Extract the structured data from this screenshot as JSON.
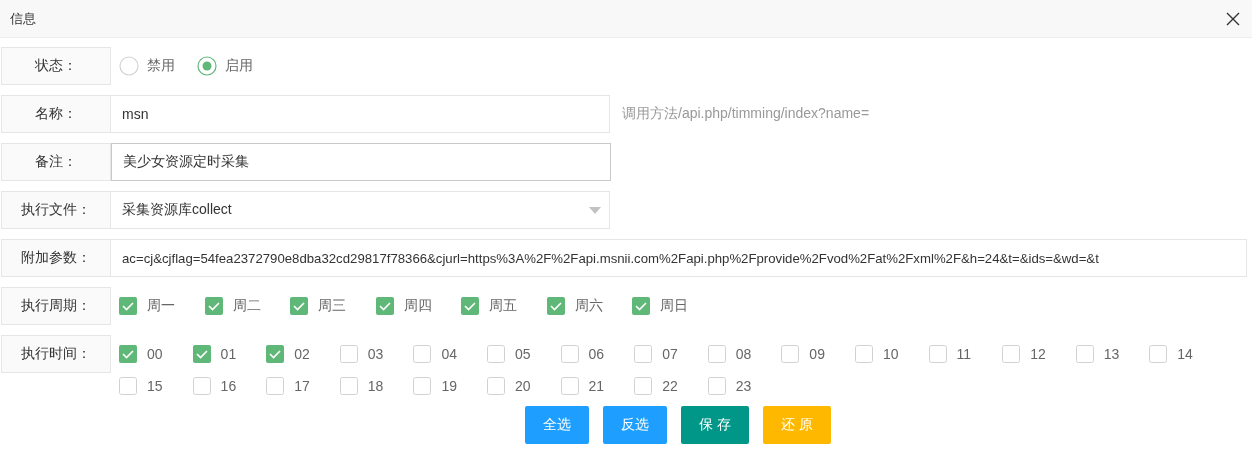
{
  "dialog": {
    "title": "信息"
  },
  "rows": [
    {
      "kind": "radio",
      "label": "状态：",
      "options": [
        {
          "label": "禁用",
          "selected": false
        },
        {
          "label": "启用",
          "selected": true
        }
      ]
    },
    {
      "kind": "input",
      "label": "名称：",
      "value": "msn",
      "focused": false,
      "note": "调用方法/api.php/timming/index?name="
    },
    {
      "kind": "input",
      "label": "备注：",
      "value": "美少女资源定时采集",
      "focused": true
    },
    {
      "kind": "select",
      "label": "执行文件：",
      "value": "采集资源库collect"
    },
    {
      "kind": "wide",
      "label": "附加参数：",
      "value": "ac=cj&cjflag=54fea2372790e8dba32cd29817f78366&cjurl=https%3A%2F%2Fapi.msnii.com%2Fapi.php%2Fprovide%2Fvod%2Fat%2Fxml%2F&h=24&t=&ids=&wd=&t"
    },
    {
      "kind": "days",
      "label": "执行周期：",
      "options": [
        {
          "label": "周一",
          "checked": true
        },
        {
          "label": "周二",
          "checked": true
        },
        {
          "label": "周三",
          "checked": true
        },
        {
          "label": "周四",
          "checked": true
        },
        {
          "label": "周五",
          "checked": true
        },
        {
          "label": "周六",
          "checked": true
        },
        {
          "label": "周日",
          "checked": true
        }
      ]
    },
    {
      "kind": "hours",
      "label": "执行时间：",
      "options": [
        {
          "label": "00",
          "checked": true
        },
        {
          "label": "01",
          "checked": true
        },
        {
          "label": "02",
          "checked": true
        },
        {
          "label": "03",
          "checked": false
        },
        {
          "label": "04",
          "checked": false
        },
        {
          "label": "05",
          "checked": false
        },
        {
          "label": "06",
          "checked": false
        },
        {
          "label": "07",
          "checked": false
        },
        {
          "label": "08",
          "checked": false
        },
        {
          "label": "09",
          "checked": false
        },
        {
          "label": "10",
          "checked": false
        },
        {
          "label": "11",
          "checked": false
        },
        {
          "label": "12",
          "checked": false
        },
        {
          "label": "13",
          "checked": false
        },
        {
          "label": "14",
          "checked": false
        },
        {
          "label": "15",
          "checked": false
        },
        {
          "label": "16",
          "checked": false
        },
        {
          "label": "17",
          "checked": false
        },
        {
          "label": "18",
          "checked": false
        },
        {
          "label": "19",
          "checked": false
        },
        {
          "label": "20",
          "checked": false
        },
        {
          "label": "21",
          "checked": false
        },
        {
          "label": "22",
          "checked": false
        },
        {
          "label": "23",
          "checked": false
        }
      ]
    }
  ],
  "buttons": [
    {
      "label": "全选",
      "kind": "normal"
    },
    {
      "label": "反选",
      "kind": "normal"
    },
    {
      "label": "保 存",
      "kind": "primary"
    },
    {
      "label": "还 原",
      "kind": "warm"
    }
  ]
}
